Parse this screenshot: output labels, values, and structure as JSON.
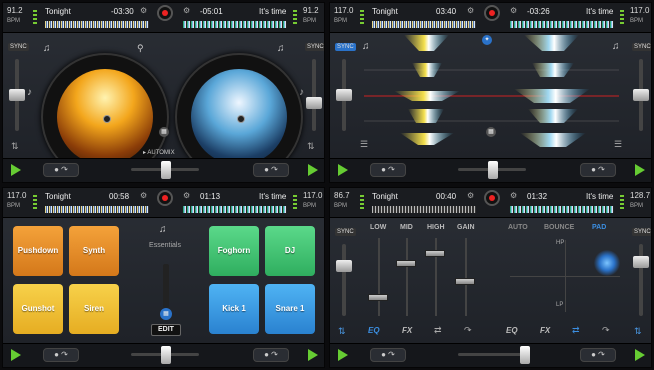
{
  "deck_tl": {
    "bpm_left": "91.2",
    "bpm_right": "91.2",
    "bpm_unit": "BPM",
    "track_left": "Tonight",
    "time_left": "-03:30",
    "time_right": "-05:01",
    "track_right": "It's time",
    "sync": "SYNC",
    "automix": "AUTOMIX"
  },
  "deck_tr": {
    "bpm_left": "117.0",
    "bpm_right": "117.0",
    "bpm_unit": "BPM",
    "track_left": "Tonight",
    "time_left": "03:40",
    "time_right": "-03:26",
    "track_right": "It's time",
    "sync_left": "SYNC",
    "sync_right": "SYNC"
  },
  "deck_bl": {
    "bpm_left": "117.0",
    "bpm_right": "117.0",
    "bpm_unit": "BPM",
    "track_left": "Tonight",
    "time_left": "00:58",
    "time_right": "01:13",
    "track_right": "It's time",
    "pack": "Essentials",
    "edit": "EDIT",
    "pads": [
      "Pushdown",
      "Synth",
      "Gunshot",
      "Siren",
      "Foghorn",
      "DJ",
      "Kick 1",
      "Snare 1"
    ]
  },
  "deck_br": {
    "bpm_left": "86.7",
    "bpm_right": "128.7",
    "bpm_unit": "BPM",
    "track_left": "Tonight",
    "time_left": "00:40",
    "time_right": "01:32",
    "track_right": "It's time",
    "sync": "SYNC",
    "eq_labels": [
      "LOW",
      "MID",
      "HIGH",
      "GAIN"
    ],
    "modes": [
      "AUTO",
      "BOUNCE",
      "PAD"
    ],
    "hp": "HP",
    "lp": "LP",
    "tabs": [
      "EQ",
      "FX",
      "EQ",
      "FX"
    ]
  },
  "colors": {
    "accent": "#3b8ee0",
    "play": "#66cc33",
    "record": "#e22222"
  }
}
